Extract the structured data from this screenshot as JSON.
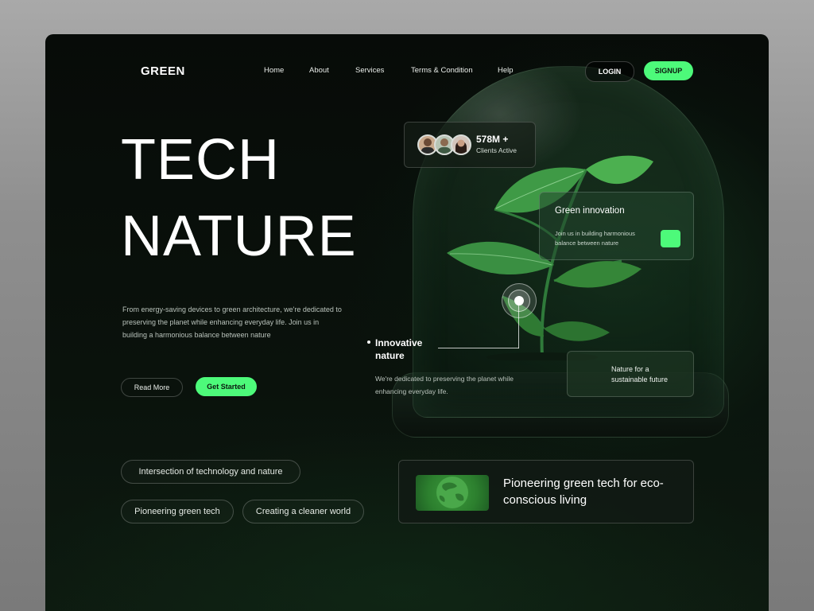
{
  "brand": {
    "logo": "GREEN"
  },
  "nav": {
    "links": [
      "Home",
      "About",
      "Services",
      "Terms & Condition",
      "Help"
    ],
    "login_label": "LOGIN",
    "signup_label": "SIGNUP"
  },
  "hero": {
    "title_line1": "TECH",
    "title_line2": "NATURE",
    "description": "From energy-saving devices to green architecture, we're dedicated to preserving the planet while enhancing everyday life. Join us in building a harmonious balance between nature",
    "read_more_label": "Read More",
    "get_started_label": "Get Started"
  },
  "tags": [
    "Intersection of technology and nature",
    "Pioneering green tech",
    "Creating a cleaner world"
  ],
  "clients": {
    "count": "578M +",
    "label": "Clients  Active"
  },
  "innovation_card": {
    "title": "Green innovation",
    "description": "Join us in building harmonious balance between nature"
  },
  "hotspot": {
    "title": "Innovative nature",
    "description": "We're dedicated to preserving the planet while enhancing everyday life."
  },
  "future_card": {
    "text": "Nature for a sustainable future"
  },
  "pioneer_card": {
    "text": "Pioneering green tech for eco-conscious living"
  },
  "colors": {
    "accent": "#4dfa7a",
    "background": "#070b08"
  }
}
